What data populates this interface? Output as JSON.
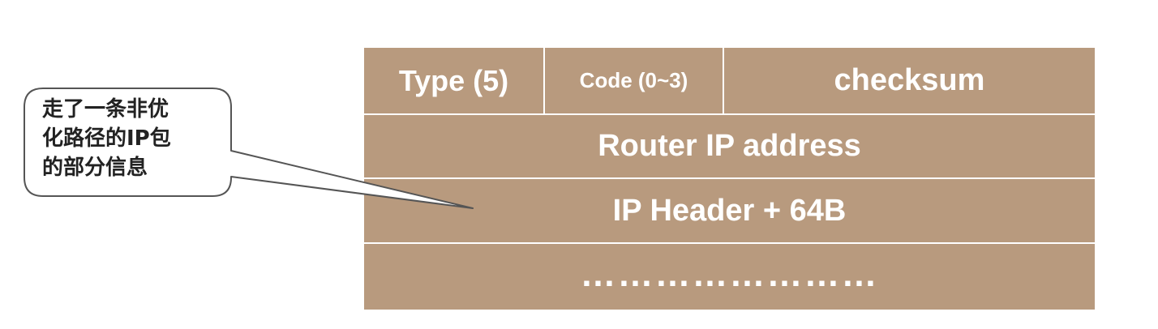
{
  "packet": {
    "type_label": "Type (5)",
    "code_label": "Code (0~3)",
    "checksum_label": "checksum",
    "router_ip_label": "Router IP address",
    "ip_header_label": "IP Header + 64B",
    "ellipsis": "……………………"
  },
  "callout": {
    "text": "走了一条非优\n化路径的IP包\n的部分信息"
  },
  "colors": {
    "packet_fill": "#b89a7e",
    "divider": "#ffffff",
    "callout_border": "#555555",
    "callout_fill": "#ffffff"
  }
}
